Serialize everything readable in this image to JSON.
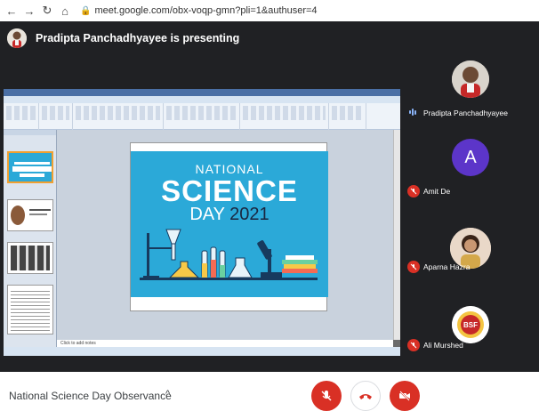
{
  "browser": {
    "url": "meet.google.com/obx-voqp-gmn?pli=1&authuser=4",
    "back_icon": "arrow-left-icon",
    "forward_icon": "arrow-right-icon",
    "reload_icon": "reload-icon",
    "home_icon": "home-icon",
    "lock_icon": "lock-icon"
  },
  "meet": {
    "presenter_banner": "Pradipta Panchadhyayee is presenting",
    "participants": [
      {
        "name": "Pradipta Panchadhyayee",
        "status": "speaking",
        "avatar": "photo"
      },
      {
        "name": "Amit De",
        "status": "muted",
        "avatar_letter": "A",
        "avatar_color": "#5c35c9"
      },
      {
        "name": "Aparna Hazra",
        "status": "muted",
        "avatar": "photo"
      },
      {
        "name": "Ali Murshed",
        "status": "muted",
        "avatar": "logo",
        "logo_text": "BSF"
      }
    ],
    "colors": {
      "background": "#202124",
      "mute_red": "#d93025",
      "speaking_blue": "#8ab4f8"
    }
  },
  "shared_screen": {
    "slide": {
      "line1": "NATIONAL",
      "line2": "SCIENCE",
      "line3": "DAY",
      "year": "2021",
      "background": "#2ba9d8"
    },
    "notes_placeholder": "Click to add notes"
  },
  "bottom_bar": {
    "meeting_title": "National Science Day Observance",
    "controls": [
      {
        "name": "mic-toggle",
        "icon": "mic-off-icon",
        "color": "#d93025"
      },
      {
        "name": "leave-call",
        "icon": "hang-up-icon",
        "color": "#ffffff"
      },
      {
        "name": "camera-toggle",
        "icon": "camera-off-icon",
        "color": "#d93025"
      }
    ]
  }
}
